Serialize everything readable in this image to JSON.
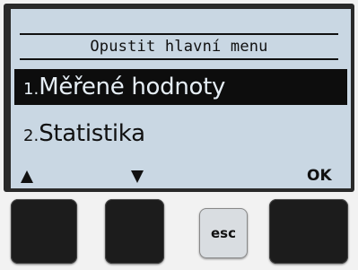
{
  "display": {
    "title": "Opustit hlavní menu",
    "menu_items": [
      {
        "number": "1.",
        "label": "Měřené hodnoty",
        "selected": true
      },
      {
        "number": "2.",
        "label": "Statistika",
        "selected": false
      }
    ],
    "softkeys": {
      "up_icon": "triangle-up",
      "down_icon": "triangle-down",
      "ok_label": "OK"
    }
  },
  "hardware_buttons": {
    "esc_label": "esc"
  }
}
